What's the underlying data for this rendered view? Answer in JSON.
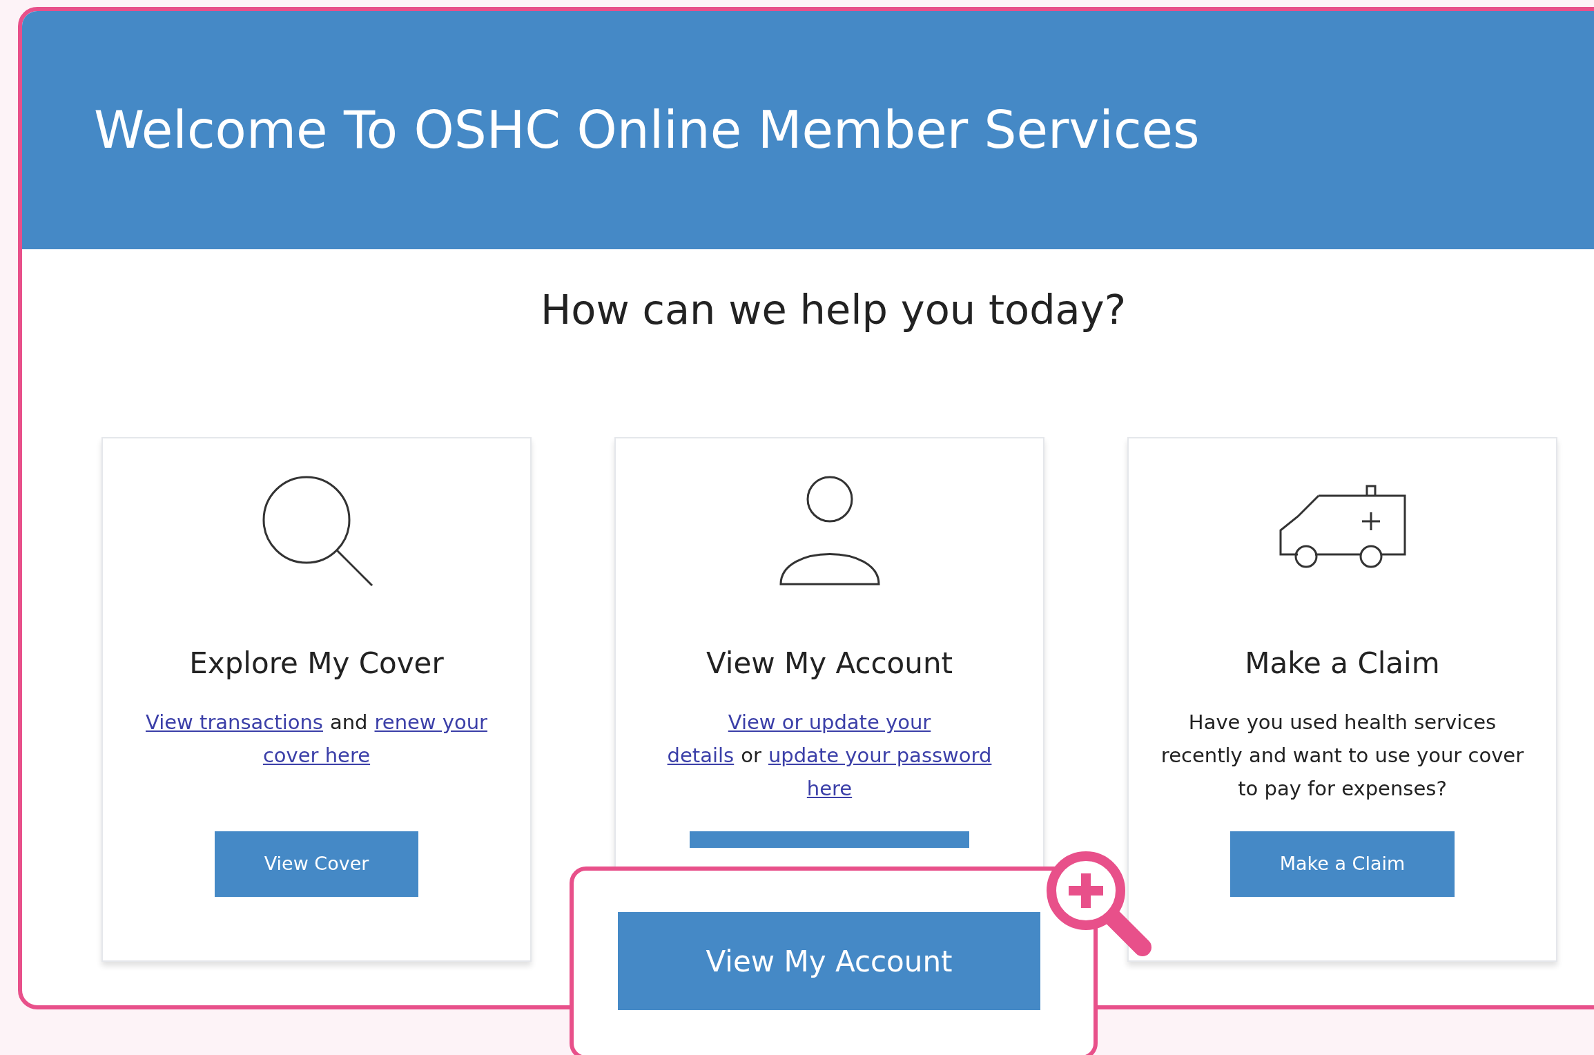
{
  "header": {
    "title": "Welcome To OSHC Online Member Services"
  },
  "heading": "How can we help you today?",
  "cards": [
    {
      "title": "Explore My Cover",
      "lines": [
        [
          {
            "kind": "link",
            "text": "View transactions"
          },
          {
            "kind": "text",
            "text": "and"
          },
          {
            "kind": "link",
            "text": "renew your"
          }
        ],
        [
          {
            "kind": "link",
            "text": "cover here"
          }
        ]
      ],
      "button": {
        "kind": "normal",
        "label": "View Cover"
      }
    },
    {
      "title": "View My Account",
      "lines": [
        [
          {
            "kind": "link",
            "text": "View or update your"
          }
        ],
        [
          {
            "kind": "link",
            "text": "details"
          },
          {
            "kind": "text",
            "text": "or"
          },
          {
            "kind": "link",
            "text": "update your password"
          }
        ],
        [
          {
            "kind": "link",
            "text": "here"
          }
        ]
      ],
      "button": {
        "kind": "covered"
      }
    },
    {
      "title": "Make a Claim",
      "lines": [
        [
          {
            "kind": "text",
            "text": "Have you used health services"
          }
        ],
        [
          {
            "kind": "text",
            "text": "recently and want to use your cover"
          }
        ],
        [
          {
            "kind": "text",
            "text": "to pay for expenses?"
          }
        ]
      ],
      "button": {
        "kind": "normal",
        "label": "Make a Claim"
      }
    }
  ],
  "callout": {
    "button": "View My Account"
  }
}
